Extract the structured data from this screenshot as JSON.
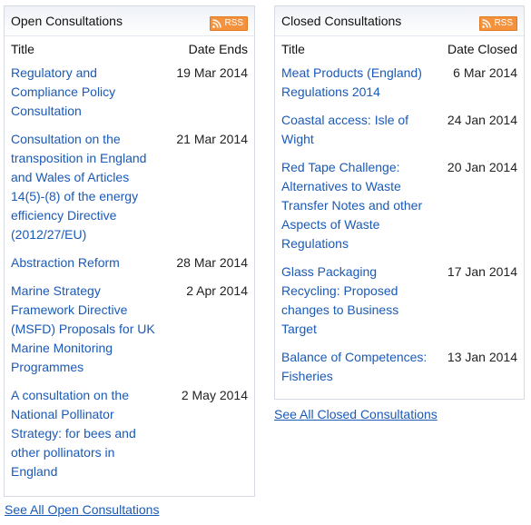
{
  "open": {
    "title": "Open Consultations",
    "rss": "RSS",
    "col_title": "Title",
    "col_date": "Date Ends",
    "items": [
      {
        "title": "Regulatory and Compliance Policy Consultation",
        "date": "19 Mar 2014"
      },
      {
        "title": "Consultation on the transposition in England and Wales of Articles 14(5)-(8) of the energy efficiency Directive (2012/27/EU)",
        "date": "21 Mar 2014"
      },
      {
        "title": "Abstraction Reform",
        "date": "28 Mar 2014"
      },
      {
        "title": "Marine Strategy Framework Directive (MSFD) Proposals for UK Marine Monitoring Programmes",
        "date": "2 Apr 2014"
      },
      {
        "title": "A consultation on the National Pollinator Strategy: for bees and other pollinators in England",
        "date": "2 May 2014"
      }
    ],
    "see_all": "See All Open Consultations"
  },
  "closed": {
    "title": "Closed Consultations",
    "rss": "RSS",
    "col_title": "Title",
    "col_date": "Date Closed",
    "items": [
      {
        "title": "Meat Products (England) Regulations 2014",
        "date": "6 Mar 2014"
      },
      {
        "title": "Coastal access: Isle of Wight",
        "date": "24 Jan 2014"
      },
      {
        "title": "Red Tape Challenge: Alternatives to Waste Transfer Notes and other Aspects of Waste Regulations",
        "date": "20 Jan 2014"
      },
      {
        "title": "Glass Packaging Recycling: Proposed changes to Business Target",
        "date": "17 Jan 2014"
      },
      {
        "title": "Balance of Competences: Fisheries",
        "date": "13 Jan 2014"
      }
    ],
    "see_all": "See All Closed Consultations"
  },
  "colors": {
    "link": "#1a5ab8",
    "rss": "#f5923e"
  },
  "icons": {
    "rss": "rss-feed-icon"
  }
}
